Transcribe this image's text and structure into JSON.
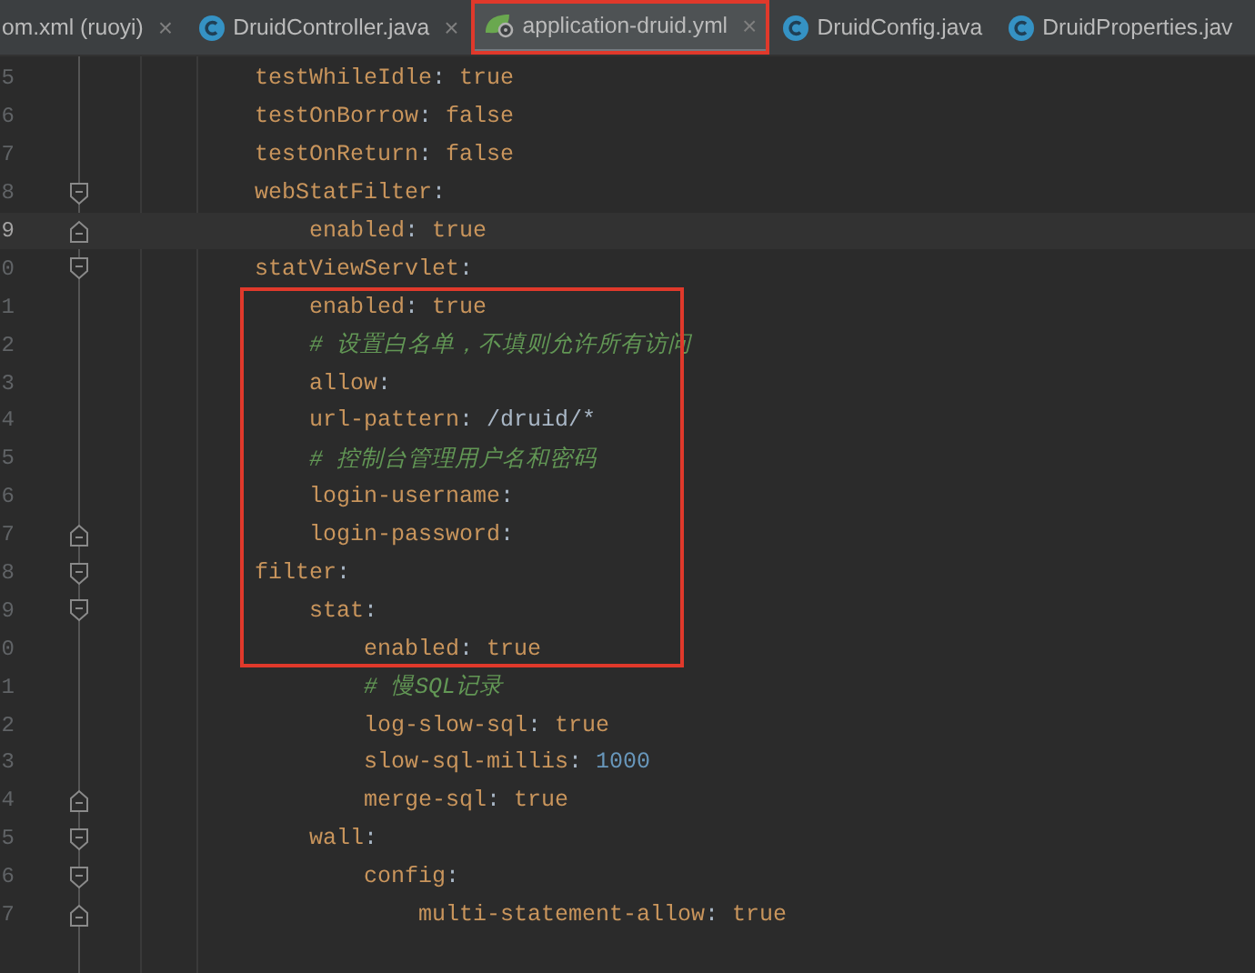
{
  "tabs": [
    {
      "label": "om.xml (ruoyi)",
      "kind": "xml",
      "selected": false,
      "highlighted": false,
      "close": "×"
    },
    {
      "label": "DruidController.java",
      "kind": "java",
      "selected": false,
      "highlighted": false,
      "close": "×"
    },
    {
      "label": "application-druid.yml",
      "kind": "yaml",
      "selected": true,
      "highlighted": true,
      "close": "×"
    },
    {
      "label": "DruidConfig.java",
      "kind": "java",
      "selected": false,
      "highlighted": false
    },
    {
      "label": "DruidProperties.jav",
      "kind": "java",
      "selected": false,
      "highlighted": false
    }
  ],
  "editor": {
    "lines": [
      {
        "line_number": "5",
        "kind": "entry",
        "key": "testWhileIdle:",
        "value": {
          "text": "true",
          "kind": "keyword"
        },
        "current": false,
        "outlined": false
      },
      {
        "line_number": "6",
        "kind": "entry",
        "key": "testOnBorrow:",
        "value": {
          "text": "false",
          "kind": "keyword"
        },
        "current": false,
        "outlined": false
      },
      {
        "line_number": "7",
        "kind": "entry",
        "key": "testOnReturn:",
        "value": {
          "text": "false",
          "kind": "keyword"
        },
        "current": false,
        "outlined": false
      },
      {
        "line_number": "8",
        "kind": "entry",
        "key": "webStatFilter:",
        "fold": {
          "kind": "start"
        },
        "current": false,
        "outlined": false,
        "children": [
          {
            "line_number": "9",
            "kind": "entry",
            "key": "enabled:",
            "value": {
              "text": "true",
              "kind": "keyword"
            },
            "fold": {
              "kind": "end"
            },
            "current": true,
            "outlined": false
          }
        ]
      },
      {
        "line_number": "0",
        "kind": "entry",
        "key": "statViewServlet:",
        "fold": {
          "kind": "start"
        },
        "current": false,
        "outlined": false,
        "children": [
          {
            "line_number": "1",
            "kind": "entry",
            "key": "enabled:",
            "value": {
              "text": "true",
              "kind": "keyword"
            },
            "current": false,
            "outlined": true
          },
          {
            "line_number": "2",
            "kind": "comment",
            "text": "#  设置白名单，不填则允许所有访问",
            "current": false,
            "outlined": true
          },
          {
            "line_number": "3",
            "kind": "entry",
            "key": "allow:",
            "current": false,
            "outlined": true
          },
          {
            "line_number": "4",
            "kind": "entry",
            "key": "url-pattern:",
            "value": {
              "text": "/druid/*",
              "kind": "text"
            },
            "current": false,
            "outlined": true
          },
          {
            "line_number": "5",
            "kind": "comment",
            "text": "#  控制台管理用户名和密码",
            "current": false,
            "outlined": true
          },
          {
            "line_number": "6",
            "kind": "entry",
            "key": "login-username:",
            "current": false,
            "outlined": true
          },
          {
            "line_number": "7",
            "kind": "entry",
            "key": "login-password:",
            "fold": {
              "kind": "end"
            },
            "current": false,
            "outlined": true
          }
        ]
      },
      {
        "line_number": "8",
        "kind": "entry",
        "key": "filter:",
        "fold": {
          "kind": "start"
        },
        "current": false,
        "outlined": true,
        "children": [
          {
            "line_number": "9",
            "kind": "entry",
            "key": "stat:",
            "fold": {
              "kind": "start"
            },
            "current": false,
            "outlined": true,
            "children": [
              {
                "line_number": "0",
                "kind": "entry",
                "key": "enabled:",
                "value": {
                  "text": "true",
                  "kind": "keyword"
                },
                "current": false,
                "outlined": true
              },
              {
                "line_number": "1",
                "kind": "comment",
                "text": "#  慢SQL记录",
                "current": false,
                "outlined": false
              },
              {
                "line_number": "2",
                "kind": "entry",
                "key": "log-slow-sql:",
                "value": {
                  "text": "true",
                  "kind": "keyword"
                },
                "current": false,
                "outlined": false
              },
              {
                "line_number": "3",
                "kind": "entry",
                "key": "slow-sql-millis:",
                "value": {
                  "text": "1000",
                  "kind": "number"
                },
                "current": false,
                "outlined": false
              },
              {
                "line_number": "4",
                "kind": "entry",
                "key": "merge-sql:",
                "value": {
                  "text": "true",
                  "kind": "keyword"
                },
                "fold": {
                  "kind": "end"
                },
                "current": false,
                "outlined": false
              }
            ]
          },
          {
            "line_number": "5",
            "kind": "entry",
            "key": "wall:",
            "fold": {
              "kind": "start"
            },
            "current": false,
            "outlined": false,
            "children": [
              {
                "line_number": "6",
                "kind": "entry",
                "key": "config:",
                "fold": {
                  "kind": "start"
                },
                "current": false,
                "outlined": false,
                "children": [
                  {
                    "line_number": "7",
                    "kind": "entry",
                    "key": "multi-statement-allow:",
                    "value": {
                      "text": "true",
                      "kind": "keyword"
                    },
                    "fold": {
                      "kind": "end"
                    },
                    "current": false,
                    "outlined": false
                  }
                ]
              }
            ]
          }
        ]
      }
    ]
  }
}
